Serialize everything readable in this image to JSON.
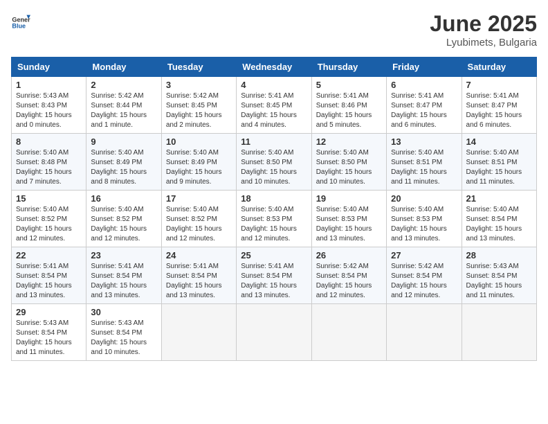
{
  "logo": {
    "general": "General",
    "blue": "Blue"
  },
  "title": {
    "month": "June 2025",
    "location": "Lyubimets, Bulgaria"
  },
  "weekdays": [
    "Sunday",
    "Monday",
    "Tuesday",
    "Wednesday",
    "Thursday",
    "Friday",
    "Saturday"
  ],
  "weeks": [
    [
      {
        "day": "1",
        "sunrise": "5:43 AM",
        "sunset": "8:43 PM",
        "daylight": "15 hours and 0 minutes."
      },
      {
        "day": "2",
        "sunrise": "5:42 AM",
        "sunset": "8:44 PM",
        "daylight": "15 hours and 1 minute."
      },
      {
        "day": "3",
        "sunrise": "5:42 AM",
        "sunset": "8:45 PM",
        "daylight": "15 hours and 2 minutes."
      },
      {
        "day": "4",
        "sunrise": "5:41 AM",
        "sunset": "8:45 PM",
        "daylight": "15 hours and 4 minutes."
      },
      {
        "day": "5",
        "sunrise": "5:41 AM",
        "sunset": "8:46 PM",
        "daylight": "15 hours and 5 minutes."
      },
      {
        "day": "6",
        "sunrise": "5:41 AM",
        "sunset": "8:47 PM",
        "daylight": "15 hours and 6 minutes."
      },
      {
        "day": "7",
        "sunrise": "5:41 AM",
        "sunset": "8:47 PM",
        "daylight": "15 hours and 6 minutes."
      }
    ],
    [
      {
        "day": "8",
        "sunrise": "5:40 AM",
        "sunset": "8:48 PM",
        "daylight": "15 hours and 7 minutes."
      },
      {
        "day": "9",
        "sunrise": "5:40 AM",
        "sunset": "8:49 PM",
        "daylight": "15 hours and 8 minutes."
      },
      {
        "day": "10",
        "sunrise": "5:40 AM",
        "sunset": "8:49 PM",
        "daylight": "15 hours and 9 minutes."
      },
      {
        "day": "11",
        "sunrise": "5:40 AM",
        "sunset": "8:50 PM",
        "daylight": "15 hours and 10 minutes."
      },
      {
        "day": "12",
        "sunrise": "5:40 AM",
        "sunset": "8:50 PM",
        "daylight": "15 hours and 10 minutes."
      },
      {
        "day": "13",
        "sunrise": "5:40 AM",
        "sunset": "8:51 PM",
        "daylight": "15 hours and 11 minutes."
      },
      {
        "day": "14",
        "sunrise": "5:40 AM",
        "sunset": "8:51 PM",
        "daylight": "15 hours and 11 minutes."
      }
    ],
    [
      {
        "day": "15",
        "sunrise": "5:40 AM",
        "sunset": "8:52 PM",
        "daylight": "15 hours and 12 minutes."
      },
      {
        "day": "16",
        "sunrise": "5:40 AM",
        "sunset": "8:52 PM",
        "daylight": "15 hours and 12 minutes."
      },
      {
        "day": "17",
        "sunrise": "5:40 AM",
        "sunset": "8:52 PM",
        "daylight": "15 hours and 12 minutes."
      },
      {
        "day": "18",
        "sunrise": "5:40 AM",
        "sunset": "8:53 PM",
        "daylight": "15 hours and 12 minutes."
      },
      {
        "day": "19",
        "sunrise": "5:40 AM",
        "sunset": "8:53 PM",
        "daylight": "15 hours and 13 minutes."
      },
      {
        "day": "20",
        "sunrise": "5:40 AM",
        "sunset": "8:53 PM",
        "daylight": "15 hours and 13 minutes."
      },
      {
        "day": "21",
        "sunrise": "5:40 AM",
        "sunset": "8:54 PM",
        "daylight": "15 hours and 13 minutes."
      }
    ],
    [
      {
        "day": "22",
        "sunrise": "5:41 AM",
        "sunset": "8:54 PM",
        "daylight": "15 hours and 13 minutes."
      },
      {
        "day": "23",
        "sunrise": "5:41 AM",
        "sunset": "8:54 PM",
        "daylight": "15 hours and 13 minutes."
      },
      {
        "day": "24",
        "sunrise": "5:41 AM",
        "sunset": "8:54 PM",
        "daylight": "15 hours and 13 minutes."
      },
      {
        "day": "25",
        "sunrise": "5:41 AM",
        "sunset": "8:54 PM",
        "daylight": "15 hours and 13 minutes."
      },
      {
        "day": "26",
        "sunrise": "5:42 AM",
        "sunset": "8:54 PM",
        "daylight": "15 hours and 12 minutes."
      },
      {
        "day": "27",
        "sunrise": "5:42 AM",
        "sunset": "8:54 PM",
        "daylight": "15 hours and 12 minutes."
      },
      {
        "day": "28",
        "sunrise": "5:43 AM",
        "sunset": "8:54 PM",
        "daylight": "15 hours and 11 minutes."
      }
    ],
    [
      {
        "day": "29",
        "sunrise": "5:43 AM",
        "sunset": "8:54 PM",
        "daylight": "15 hours and 11 minutes."
      },
      {
        "day": "30",
        "sunrise": "5:43 AM",
        "sunset": "8:54 PM",
        "daylight": "15 hours and 10 minutes."
      },
      null,
      null,
      null,
      null,
      null
    ]
  ]
}
